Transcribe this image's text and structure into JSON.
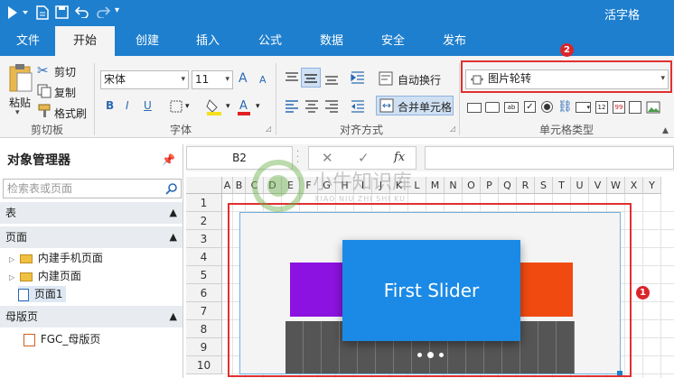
{
  "app": {
    "brand": "活字格"
  },
  "tabs": [
    "文件",
    "开始",
    "创建",
    "插入",
    "公式",
    "数据",
    "安全",
    "发布"
  ],
  "active_tab": 1,
  "clipboard": {
    "paste": "粘贴",
    "cut": "剪切",
    "copy": "复制",
    "format_painter": "格式刷",
    "group": "剪切板"
  },
  "font": {
    "name": "宋体",
    "size": "11",
    "bold": "B",
    "italic": "I",
    "underline": "U",
    "grow": "A",
    "shrink": "A",
    "group": "字体"
  },
  "alignment": {
    "wrap": "自动换行",
    "merge": "合并单元格",
    "group": "对齐方式"
  },
  "celltype": {
    "selected": "图片轮转",
    "group": "单元格类型"
  },
  "sidebar": {
    "title": "对象管理器",
    "search_placeholder": "检索表或页面",
    "sections": {
      "tables": "表",
      "pages": "页面",
      "masters": "母版页"
    },
    "tree": {
      "mobile": "内建手机页面",
      "builtin": "内建页面",
      "page1": "页面1",
      "master": "FGC_母版页"
    }
  },
  "formula": {
    "cell_ref": "B2",
    "cancel": "✕",
    "confirm": "✓",
    "fx": "fx"
  },
  "grid": {
    "columns": [
      "A",
      "B",
      "C",
      "D",
      "E",
      "F",
      "G",
      "H",
      "I",
      "J",
      "K",
      "L",
      "M",
      "N",
      "O",
      "P",
      "Q",
      "R",
      "S",
      "T",
      "U",
      "V",
      "W",
      "X",
      "Y"
    ],
    "rows": [
      "1",
      "2",
      "3",
      "4",
      "5",
      "6",
      "7",
      "8",
      "9",
      "10"
    ]
  },
  "slider": {
    "caption": "First Slider",
    "colors": {
      "left": "#8b12e0",
      "center": "#1a8ae6",
      "right": "#f04a10"
    }
  },
  "badges": {
    "one": "1",
    "two": "2"
  },
  "watermark": {
    "cn": "小牛知识库",
    "en": "XIAO NIU ZHI SHI KU"
  }
}
